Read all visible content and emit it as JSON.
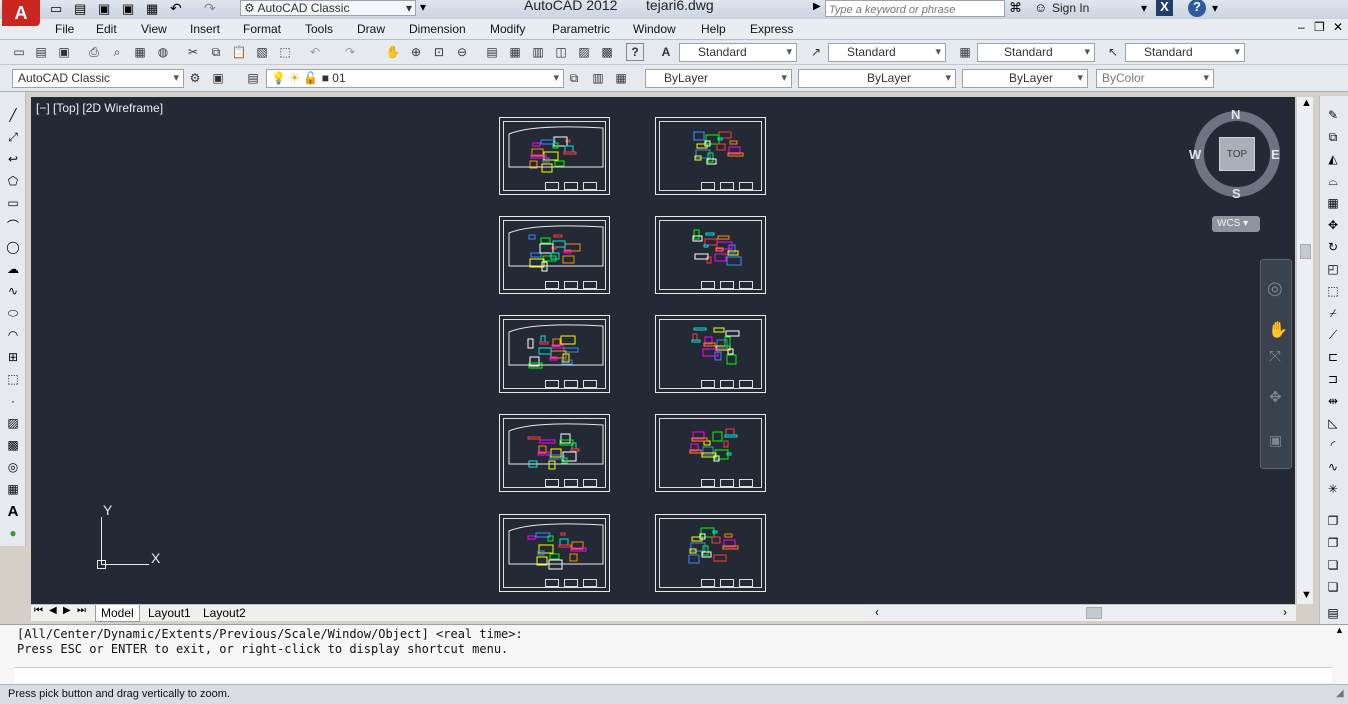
{
  "app": {
    "title": "AutoCAD 2012",
    "file": "tejari6.dwg",
    "workspace": "AutoCAD Classic",
    "search_placeholder": "Type a keyword or phrase",
    "sign_in": "Sign In"
  },
  "menu": [
    "File",
    "Edit",
    "View",
    "Insert",
    "Format",
    "Tools",
    "Draw",
    "Dimension",
    "Modify",
    "Parametric",
    "Window",
    "Help",
    "Express"
  ],
  "styles": {
    "text_style": "Standard",
    "dim_style": "Standard",
    "table_style": "Standard",
    "mleader_style": "Standard"
  },
  "layers": {
    "workspace": "AutoCAD Classic",
    "current_layer": "01",
    "color": "ByLayer",
    "linetype": "ByLayer",
    "lineweight": "ByLayer",
    "plotstyle": "ByColor"
  },
  "viewport": {
    "label": "[−] [Top] [2D Wireframe]",
    "compass": {
      "n": "N",
      "s": "S",
      "e": "E",
      "w": "W",
      "center": "TOP"
    },
    "wcs": "WCS",
    "ucs_y": "Y",
    "ucs_x": "X"
  },
  "layout_tabs": [
    "Model",
    "Layout1",
    "Layout2"
  ],
  "command": {
    "line1": "[All/Center/Dynamic/Extents/Previous/Scale/Window/Object] <real time>:",
    "line2": "Press ESC or ENTER to exit, or right-click to display shortcut menu."
  },
  "status": "Press pick button and drag vertically to zoom.",
  "colors": {
    "canvas": "#232a35",
    "accent_red": "#c8261e"
  }
}
